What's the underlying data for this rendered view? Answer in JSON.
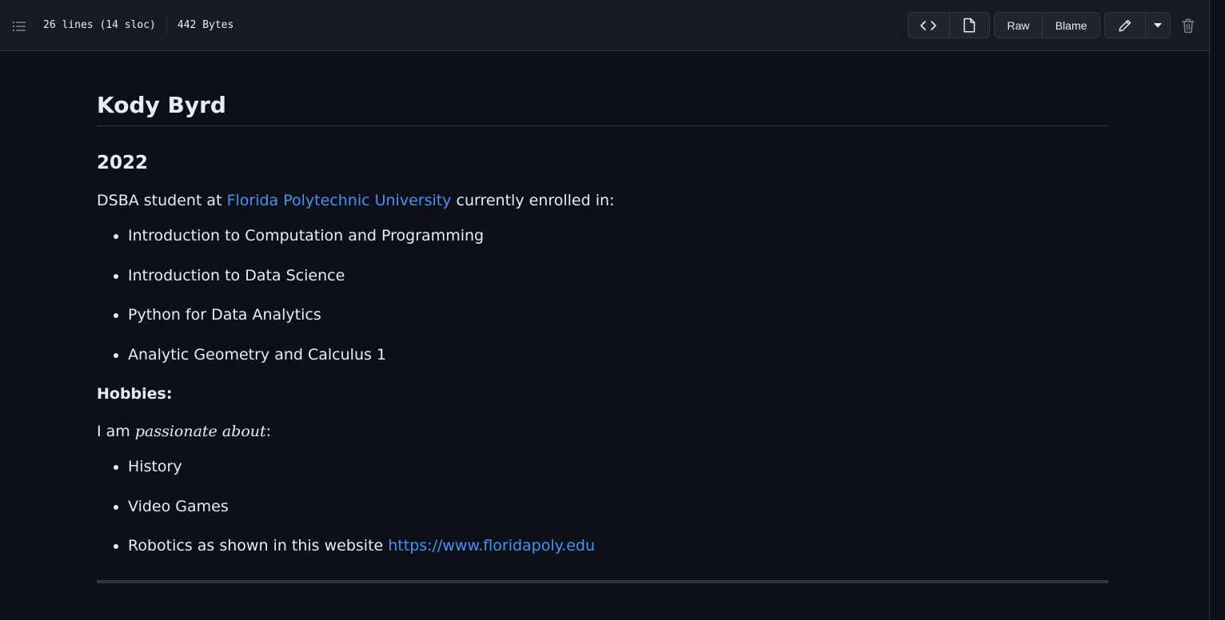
{
  "file_header": {
    "lines_info": "26 lines (14 sloc)",
    "size_info": "442 Bytes",
    "raw_label": "Raw",
    "blame_label": "Blame"
  },
  "content": {
    "title": "Kody Byrd",
    "year_heading": "2022",
    "intro_prefix": "DSBA student at ",
    "university_link": "Florida Polytechnic University",
    "intro_suffix": " currently enrolled in:",
    "courses": [
      "Introduction to Computation and Programming",
      "Introduction to Data Science",
      "Python for Data Analytics",
      "Analytic Geometry and Calculus 1"
    ],
    "hobbies_label": "Hobbies:",
    "passion_prefix": "I am ",
    "passion_emphasis": "passionate about",
    "passion_suffix": ":",
    "hobbies": [
      "History",
      "Video Games"
    ],
    "robotics_prefix": "Robotics as shown in this website ",
    "robotics_link": "https://www.floridapoly.edu"
  },
  "icons": {
    "toc": "list-unordered-icon",
    "code": "code-icon",
    "preview": "file-icon",
    "edit": "pencil-icon",
    "dropdown": "triangle-down-icon",
    "delete": "trash-icon"
  },
  "colors": {
    "background": "#0d1117",
    "header_background": "#161b22",
    "border": "#30363d",
    "text": "#e6edf3",
    "muted": "#7d8590",
    "link": "#4493f8"
  }
}
